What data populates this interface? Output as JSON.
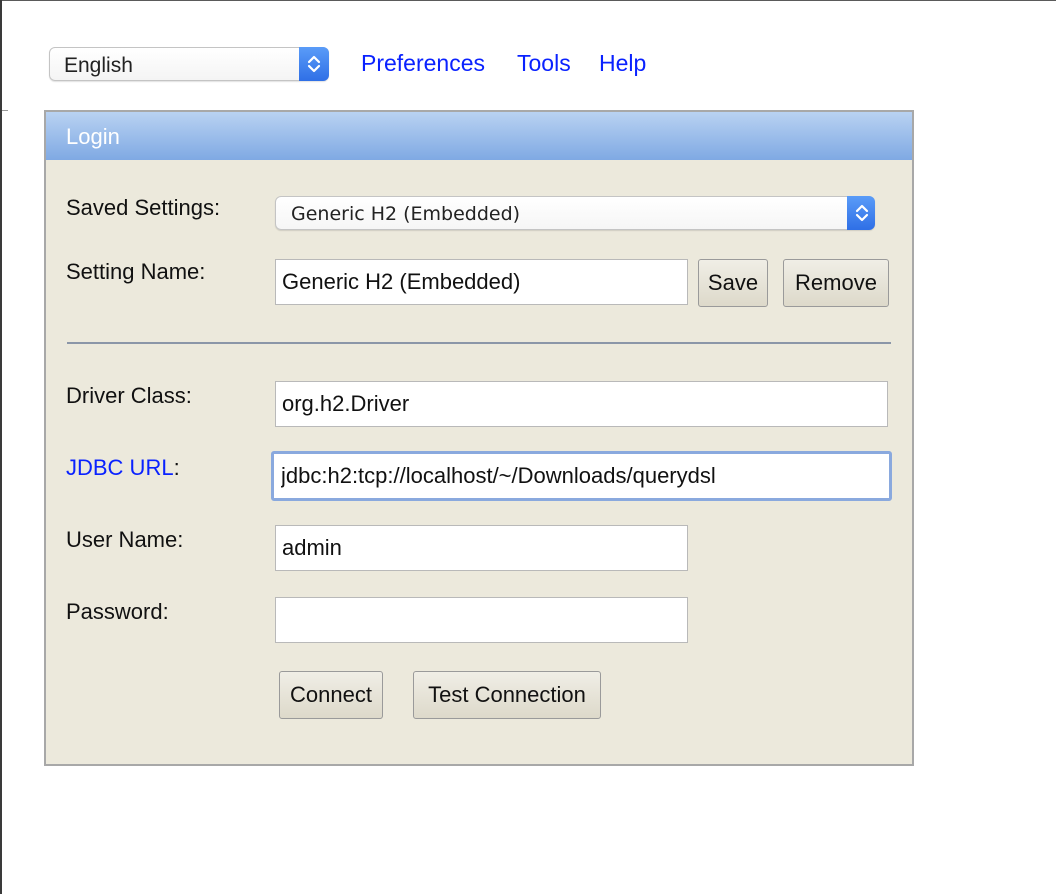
{
  "top_nav": {
    "language_select": {
      "value": "English"
    },
    "links": {
      "preferences": "Preferences",
      "tools": "Tools",
      "help": "Help"
    }
  },
  "login_panel": {
    "title": "Login",
    "saved_settings": {
      "label": "Saved Settings:",
      "value": "Generic H2 (Embedded)"
    },
    "setting_name": {
      "label": "Setting Name:",
      "value": "Generic H2 (Embedded)"
    },
    "buttons": {
      "save": "Save",
      "remove": "Remove",
      "connect": "Connect",
      "test_connection": "Test Connection"
    },
    "driver_class": {
      "label": "Driver Class:",
      "value": "org.h2.Driver"
    },
    "jdbc_url": {
      "label_link": "JDBC URL",
      "label_suffix": ":",
      "value": "jdbc:h2:tcp://localhost/~/Downloads/querydsl"
    },
    "user_name": {
      "label": "User Name:",
      "value": "admin"
    },
    "password": {
      "label": "Password:",
      "value": ""
    }
  },
  "colors": {
    "link_blue": "#0a22ff",
    "panel_background": "#ece9dc",
    "header_gradient_top": "#b9d2f2",
    "header_gradient_bottom": "#7fa9e3",
    "stepper_blue": "#3a7cf0",
    "focus_ring": "#8aa9de"
  },
  "icons": {
    "select_stepper": "chevron-up-down-icon"
  }
}
